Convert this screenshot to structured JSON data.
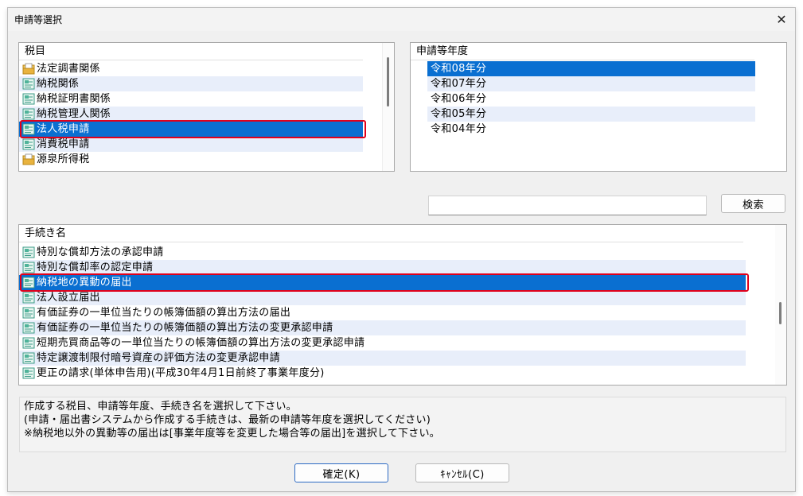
{
  "window": {
    "title": "申請等選択",
    "close_glyph": "✕"
  },
  "tax_panel": {
    "header": "税目",
    "items": [
      {
        "label": "法定調書関係",
        "icon": "folder-doc-icon"
      },
      {
        "label": "納税関係",
        "icon": "form-doc-icon"
      },
      {
        "label": "納税証明書関係",
        "icon": "form-doc-icon"
      },
      {
        "label": "納税管理人関係",
        "icon": "form-doc-icon"
      },
      {
        "label": "法人税申請",
        "icon": "form-doc-icon",
        "selected": true
      },
      {
        "label": "消費税申請",
        "icon": "form-doc-icon"
      },
      {
        "label": "源泉所得税",
        "icon": "folder-doc-icon"
      }
    ]
  },
  "year_panel": {
    "header": "申請等年度",
    "items": [
      {
        "label": "令和08年分",
        "selected": true
      },
      {
        "label": "令和07年分"
      },
      {
        "label": "令和06年分"
      },
      {
        "label": "令和05年分"
      },
      {
        "label": "令和04年分"
      }
    ]
  },
  "search": {
    "value": "",
    "button_label": "検索"
  },
  "procedure_panel": {
    "header": "手続き名",
    "items": [
      {
        "label": "特別な償却方法の承認申請"
      },
      {
        "label": "特別な償却率の認定申請"
      },
      {
        "label": "納税地の異動の届出",
        "selected": true
      },
      {
        "label": "法人設立届出"
      },
      {
        "label": "有価証券の一単位当たりの帳簿価額の算出方法の届出"
      },
      {
        "label": "有価証券の一単位当たりの帳簿価額の算出方法の変更承認申請"
      },
      {
        "label": "短期売買商品等の一単位当たりの帳簿価額の算出方法の変更承認申請"
      },
      {
        "label": "特定譲渡制限付暗号資産の評価方法の変更承認申請"
      },
      {
        "label": "更正の請求(単体申告用)(平成30年4月1日前終了事業年度分)"
      }
    ]
  },
  "message": {
    "lines": [
      "作成する税目、申請等年度、手続き名を選択して下さい。",
      "(申請・届出書システムから作成する手続きは、最新の申請等年度を選択してください)",
      "※納税地以外の異動等の届出は[事業年度等を変更した場合等の届出]を選択して下さい。"
    ]
  },
  "buttons": {
    "ok_label": "確定(K)",
    "cancel_label": "ｷｬﾝｾﾙ(C)"
  },
  "colors": {
    "selection": "#0a6fd1",
    "alt_row": "#e8eefa",
    "highlight": "#e0001b"
  }
}
